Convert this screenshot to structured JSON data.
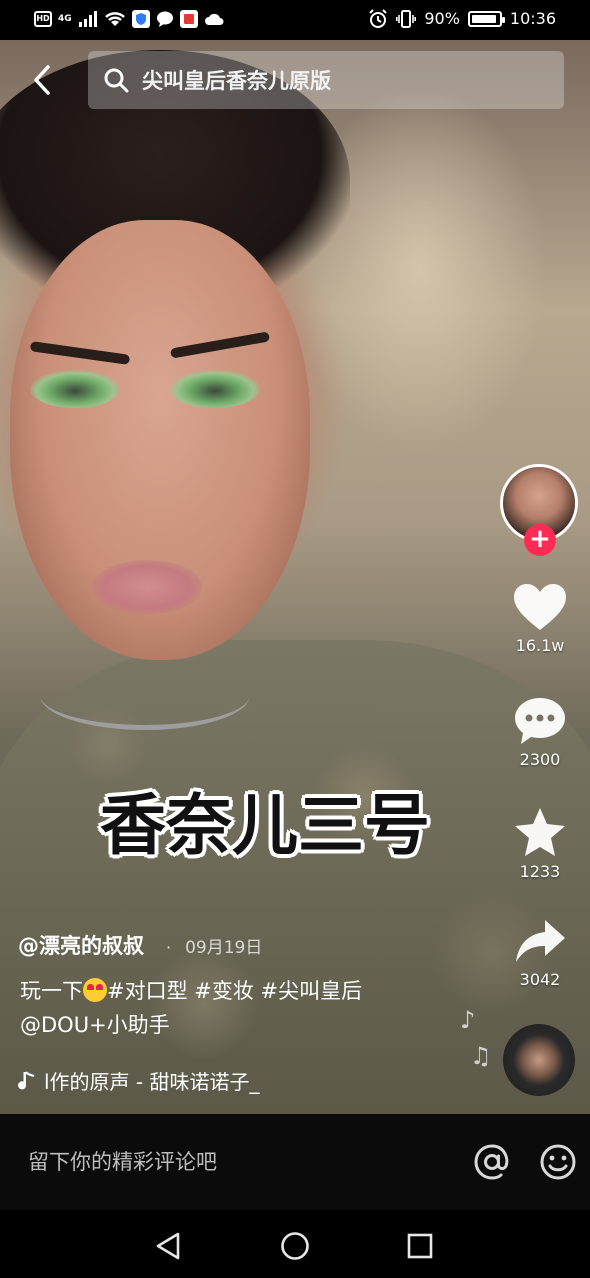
{
  "status_bar": {
    "network": "4G",
    "battery": "90%",
    "time": "10:36",
    "battery_level": 0.9
  },
  "search": {
    "query": "尖叫皇后香奈儿原版"
  },
  "video": {
    "overlay_title": "香奈儿三号"
  },
  "actions": {
    "likes": "16.1w",
    "comments": "2300",
    "favorites": "1233",
    "shares": "3042"
  },
  "post": {
    "author": "@漂亮的叔叔",
    "date": "09月19日",
    "caption_part1": "玩一下",
    "caption_part2": "#对口型 #变妆 #尖叫皇后",
    "caption_line2": "@DOU+小助手",
    "music": "l作的原声 - 甜味诺诺子_"
  },
  "comment_bar": {
    "placeholder": "留下你的精彩评论吧"
  },
  "colors": {
    "follow_accent": "#fe2c55",
    "comment_bar_bg": "#0b0b0b"
  },
  "icons": {
    "back": "chevron-left-icon",
    "search": "search-icon",
    "like": "heart-icon",
    "comment": "comment-bubble-icon",
    "favorite": "star-icon",
    "share": "share-arrow-icon",
    "music": "music-note-icon",
    "at": "at-sign-icon",
    "emoji": "smiley-icon"
  }
}
